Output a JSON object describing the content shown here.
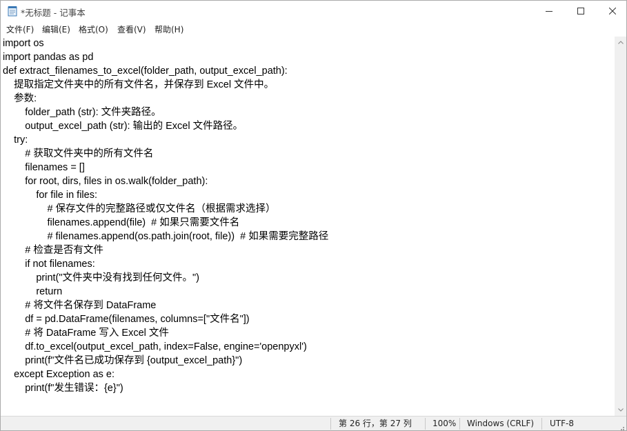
{
  "window": {
    "title": "*无标题 - 记事本",
    "icon": "notepad-icon"
  },
  "menu": [
    {
      "label": "文件(F)"
    },
    {
      "label": "编辑(E)"
    },
    {
      "label": "格式(O)"
    },
    {
      "label": "查看(V)"
    },
    {
      "label": "帮助(H)"
    }
  ],
  "editor": {
    "lines": [
      "import os",
      "import pandas as pd",
      "def extract_filenames_to_excel(folder_path, output_excel_path):",
      "    提取指定文件夹中的所有文件名，并保存到 Excel 文件中。",
      "    参数:",
      "        folder_path (str): 文件夹路径。",
      "        output_excel_path (str): 输出的 Excel 文件路径。",
      "    try:",
      "        # 获取文件夹中的所有文件名",
      "        filenames = []",
      "        for root, dirs, files in os.walk(folder_path):",
      "            for file in files:",
      "                # 保存文件的完整路径或仅文件名（根据需求选择）",
      "                filenames.append(file)  # 如果只需要文件名",
      "                # filenames.append(os.path.join(root, file))  # 如果需要完整路径",
      "        # 检查是否有文件",
      "        if not filenames:",
      "            print(\"文件夹中没有找到任何文件。\")",
      "            return",
      "        # 将文件名保存到 DataFrame",
      "        df = pd.DataFrame(filenames, columns=[\"文件名\"])",
      "        # 将 DataFrame 写入 Excel 文件",
      "        df.to_excel(output_excel_path, index=False, engine='openpyxl')",
      "        print(f\"文件名已成功保存到 {output_excel_path}\")",
      "    except Exception as e:",
      "        print(f\"发生错误：{e}\")"
    ]
  },
  "status": {
    "position": "第 26 行，第 27 列",
    "zoom": "100%",
    "line_ending": "Windows (CRLF)",
    "encoding": "UTF-8"
  }
}
